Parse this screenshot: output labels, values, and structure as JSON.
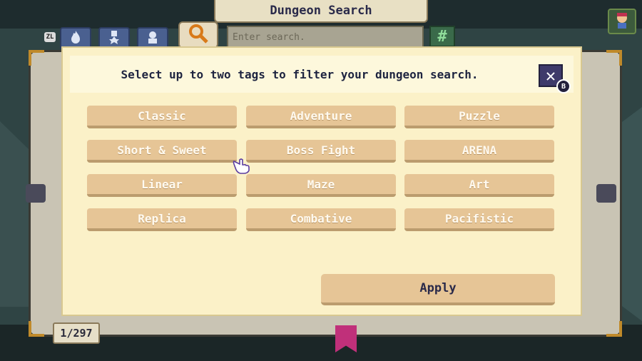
{
  "header": {
    "title": "Dungeon Search"
  },
  "toolbar": {
    "zl_label": "ZL",
    "search_placeholder": "Enter search.",
    "hash_label": "#"
  },
  "dialog": {
    "instruction": "Select up to two tags to filter your dungeon search.",
    "close_label": "✕",
    "close_hint": "B",
    "tags": [
      "Classic",
      "Adventure",
      "Puzzle",
      "Short & Sweet",
      "Boss Fight",
      "ARENA",
      "Linear",
      "Maze",
      "Art",
      "Replica",
      "Combative",
      "Pacifistic"
    ],
    "apply_label": "Apply"
  },
  "footer": {
    "page_counter": "1/297"
  },
  "colors": {
    "tag_fill": "#e6c596",
    "dialog_bg": "#fbf1c8",
    "close_bg": "#3e3a6a",
    "bookmark": "#c0307a"
  }
}
